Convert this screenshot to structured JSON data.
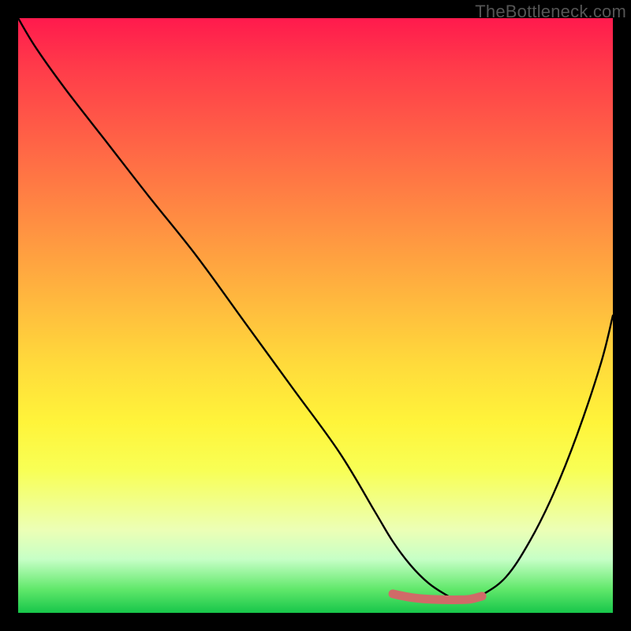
{
  "watermark": "TheBottleneck.com",
  "colors": {
    "frame": "#000000",
    "curve": "#000000",
    "marker": "#d06a68"
  },
  "chart_data": {
    "type": "line",
    "title": "",
    "xlabel": "",
    "ylabel": "",
    "xlim": [
      0,
      100
    ],
    "ylim": [
      0,
      100
    ],
    "grid": false,
    "legend_position": "none",
    "series": [
      {
        "name": "bottleneck-curve",
        "x": [
          0,
          3,
          8,
          15,
          22,
          30,
          38,
          46,
          54,
          60,
          63,
          66,
          69,
          72,
          74,
          76,
          78,
          82,
          86,
          90,
          94,
          98,
          100
        ],
        "values": [
          100,
          95,
          88,
          79,
          70,
          60,
          49,
          38,
          27,
          17,
          12,
          8,
          5,
          3,
          2,
          2,
          3,
          6,
          12,
          20,
          30,
          42,
          50
        ]
      },
      {
        "name": "optimal-range-marker",
        "x": [
          63,
          66,
          69,
          72,
          74,
          76,
          78
        ],
        "values": [
          3.2,
          2.6,
          2.3,
          2.2,
          2.2,
          2.3,
          2.8
        ]
      }
    ],
    "annotations": []
  }
}
